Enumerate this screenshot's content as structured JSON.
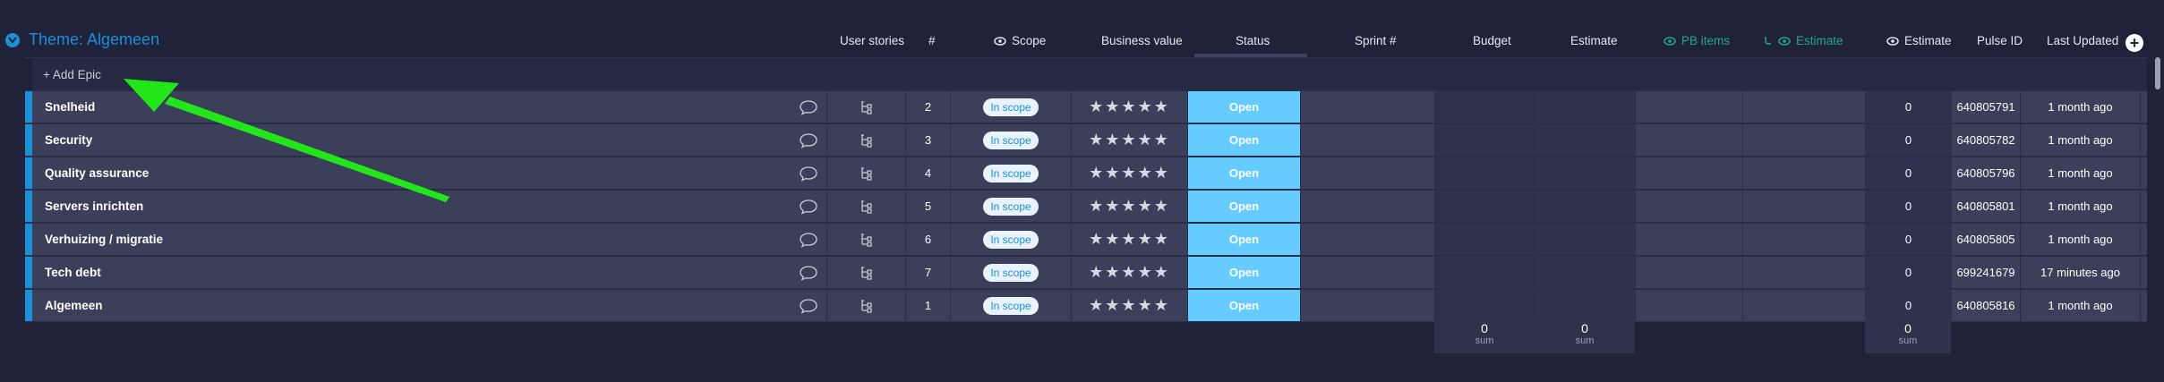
{
  "group": {
    "title": "Theme: Algemeen"
  },
  "columns": {
    "user_stories": "User stories",
    "number": "#",
    "scope": "Scope",
    "business_value": "Business value",
    "status": "Status",
    "sprint": "Sprint #",
    "budget": "Budget",
    "estimate": "Estimate",
    "pb_items": "PB items",
    "estimate_mirror": "Estimate",
    "estimate_count": "Estimate",
    "pulse_id": "Pulse ID",
    "last_updated": "Last Updated"
  },
  "add_epic": {
    "placeholder": "+ Add Epic"
  },
  "rows": [
    {
      "name": "Snelheid",
      "num": "2",
      "scope": "In scope",
      "stars": "★★★★★",
      "status": "Open",
      "estimate": "0",
      "pulse": "640805791",
      "updated": "1 month ago"
    },
    {
      "name": "Security",
      "num": "3",
      "scope": "In scope",
      "stars": "★★★★★",
      "status": "Open",
      "estimate": "0",
      "pulse": "640805782",
      "updated": "1 month ago"
    },
    {
      "name": "Quality assurance",
      "num": "4",
      "scope": "In scope",
      "stars": "★★★★★",
      "status": "Open",
      "estimate": "0",
      "pulse": "640805796",
      "updated": "1 month ago"
    },
    {
      "name": "Servers inrichten",
      "num": "5",
      "scope": "In scope",
      "stars": "★★★★★",
      "status": "Open",
      "estimate": "0",
      "pulse": "640805801",
      "updated": "1 month ago"
    },
    {
      "name": "Verhuizing / migratie",
      "num": "6",
      "scope": "In scope",
      "stars": "★★★★★",
      "status": "Open",
      "estimate": "0",
      "pulse": "640805805",
      "updated": "1 month ago"
    },
    {
      "name": "Tech debt",
      "num": "7",
      "scope": "In scope",
      "stars": "★★★★★",
      "status": "Open",
      "estimate": "0",
      "pulse": "699241679",
      "updated": "17 minutes ago"
    },
    {
      "name": "Algemeen",
      "num": "1",
      "scope": "In scope",
      "stars": "★★★★★",
      "status": "Open",
      "estimate": "0",
      "pulse": "640805816",
      "updated": "1 month ago"
    }
  ],
  "sums": {
    "budget": {
      "value": "0",
      "label": "sum"
    },
    "estimate": {
      "value": "0",
      "label": "sum"
    },
    "estimate_count": {
      "value": "0",
      "label": "sum"
    }
  },
  "colors": {
    "accent": "#1c8fd6",
    "status_open": "#66ccff",
    "annotation": "#22e61a"
  },
  "icons": {
    "toggle": "chevron-down-icon",
    "eye": "eye-icon",
    "mirror": "mirror-icon",
    "chat": "chat-bubble-icon",
    "subitems": "subitems-icon",
    "add": "plus-circle-icon"
  }
}
